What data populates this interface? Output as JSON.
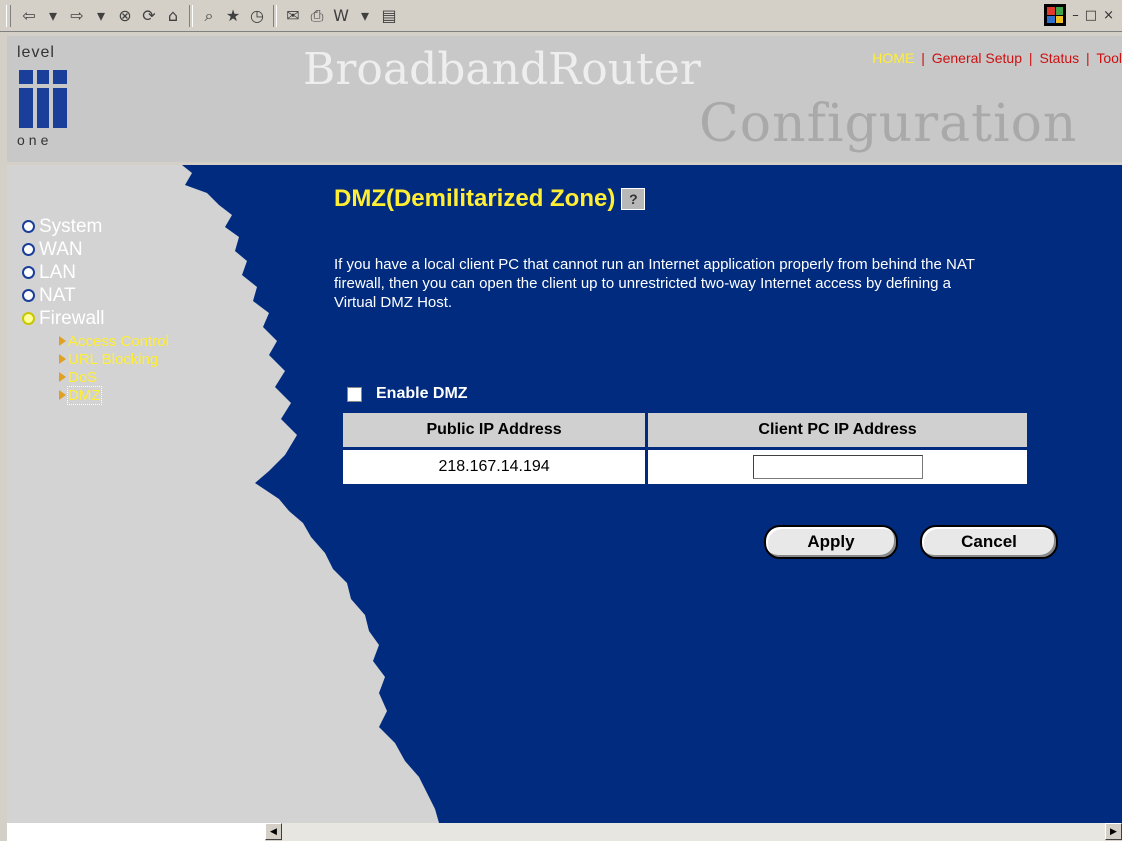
{
  "browser_toolbar": {
    "icons": [
      "back-icon",
      "dropdown-icon",
      "forward-icon",
      "dropdown-icon",
      "stop-icon",
      "refresh-icon",
      "home-icon",
      "search-icon",
      "favorites-icon",
      "history-icon",
      "mail-icon",
      "print-icon",
      "edit-icon",
      "dropdown-icon",
      "discuss-icon"
    ],
    "glyphs": [
      "⇦",
      "▾",
      "⇨",
      "▾",
      "⊗",
      "⟳",
      "⌂",
      "⌕",
      "★",
      "◷",
      "✉",
      "⎙",
      "W",
      "▾",
      "▤"
    ],
    "window_controls": [
      "–",
      "□",
      "×"
    ]
  },
  "header": {
    "logo_top": "level",
    "logo_bottom": "one",
    "title_main": "BroadbandRouter",
    "title_sub": "Configuration",
    "nav": [
      "HOME",
      "General Setup",
      "Status",
      "Tool"
    ],
    "nav_separator": "|"
  },
  "sidebar": {
    "items": [
      {
        "label": "System"
      },
      {
        "label": "WAN"
      },
      {
        "label": "LAN"
      },
      {
        "label": "NAT"
      },
      {
        "label": "Firewall"
      }
    ],
    "firewall_submenu": [
      {
        "label": "Access Control"
      },
      {
        "label": "URL Blocking"
      },
      {
        "label": "DoS"
      },
      {
        "label": "DMZ"
      }
    ]
  },
  "content": {
    "title": "DMZ(Demilitarized Zone)",
    "help_glyph": "?",
    "description": "If you have a local client PC that cannot run an Internet application properly from behind the NAT firewall, then you can open the client up to unrestricted two-way Internet access by defining a Virtual DMZ Host.",
    "enable_label": "Enable DMZ",
    "table": {
      "headers": [
        "Public IP Address",
        "Client PC IP Address"
      ],
      "public_ip": "218.167.14.194",
      "client_ip": ""
    },
    "apply_label": "Apply",
    "cancel_label": "Cancel"
  },
  "colors": {
    "main_bg": "#002b7f",
    "title_yellow": "#ffee33",
    "nav_red": "#cc1111"
  }
}
